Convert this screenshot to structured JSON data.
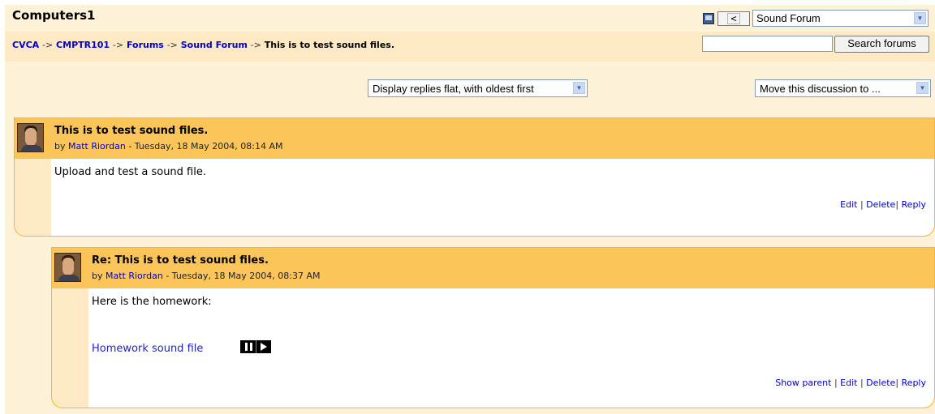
{
  "header": {
    "site_title": "Computers1",
    "prev_label": "<",
    "forum_jump_selected": "Sound Forum"
  },
  "breadcrumb": {
    "items": [
      "CVCA",
      "CMPTR101",
      "Forums",
      "Sound Forum"
    ],
    "current": "This is to test sound files.",
    "separator": "->"
  },
  "search": {
    "value": "",
    "button_label": "Search forums"
  },
  "controls": {
    "display_mode": "Display replies flat, with oldest first",
    "move_discussion": "Move this discussion to ..."
  },
  "posts": [
    {
      "subject": "This is to test sound files.",
      "by": "by",
      "author": "Matt Riordan",
      "date": "- Tuesday, 18 May 2004, 08:14 AM",
      "message": "Upload and test a sound file.",
      "actions": [
        "Edit",
        "Delete",
        "Reply"
      ]
    },
    {
      "subject": "Re: This is to test sound files.",
      "by": "by",
      "author": "Matt Riordan",
      "date": "- Tuesday, 18 May 2004, 08:37 AM",
      "message": "Here is the homework:",
      "attachment": "Homework sound file",
      "actions": [
        "Show parent",
        "Edit",
        "Delete",
        "Reply"
      ]
    }
  ],
  "colors": {
    "page_bg": "#fdf1d8",
    "breadcrumb_bg": "#fde9c4",
    "post_header": "#fcc55a",
    "post_border": "#f5b633",
    "link": "#0000cc"
  }
}
